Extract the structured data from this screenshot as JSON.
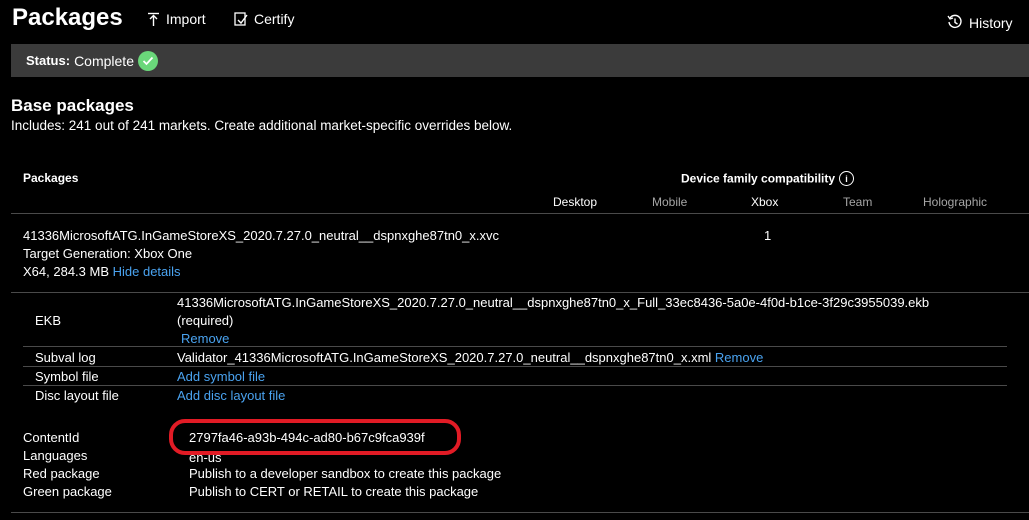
{
  "header": {
    "title": "Packages",
    "import_label": "Import",
    "certify_label": "Certify",
    "history_label": "History"
  },
  "status": {
    "label": "Status:",
    "value": "Complete"
  },
  "base": {
    "title": "Base packages",
    "subtitle": "Includes: 241 out of 241 markets. Create additional market-specific overrides below."
  },
  "table": {
    "packages_header": "Packages",
    "device_header": "Device family compatibility",
    "devices": [
      "Desktop",
      "Mobile",
      "Xbox",
      "Team",
      "Holographic"
    ]
  },
  "package": {
    "name": "41336MicrosoftATG.InGameStoreXS_2020.7.27.0_neutral__dspnxghe87tn0_x.xvc",
    "target": "Target Generation: Xbox One",
    "arch_size": "X64, 284.3 MB",
    "hide_details": "Hide details",
    "xbox_value": "1"
  },
  "details": {
    "ekb_label": "EKB",
    "ekb_file": "41336MicrosoftATG.InGameStoreXS_2020.7.27.0_neutral__dspnxghe87tn0_x_Full_33ec8436-5a0e-4f0d-b1ce-3f29c3955039.ekb",
    "ekb_required": "(required)",
    "ekb_remove": "Remove",
    "subval_label": "Subval log",
    "subval_file": "Validator_41336MicrosoftATG.InGameStoreXS_2020.7.27.0_neutral__dspnxghe87tn0_x.xml",
    "subval_remove": "Remove",
    "symbol_label": "Symbol file",
    "symbol_add": "Add symbol file",
    "disc_label": "Disc layout file",
    "disc_add": "Add disc layout file"
  },
  "info": {
    "contentid_label": "ContentId",
    "contentid_value": "2797fa46-a93b-494c-ad80-b67c9fca939f",
    "languages_label": "Languages",
    "languages_value": "en-us",
    "red_label": "Red package",
    "red_value": "Publish to a developer sandbox to create this package",
    "green_label": "Green package",
    "green_value": "Publish to CERT or RETAIL to create this package"
  },
  "colors": {
    "background": "#000000",
    "status_bar": "#3b3b3b",
    "check_green": "#6ad77a",
    "link_blue": "#4aa3f0",
    "highlight_red": "#e11b25"
  }
}
